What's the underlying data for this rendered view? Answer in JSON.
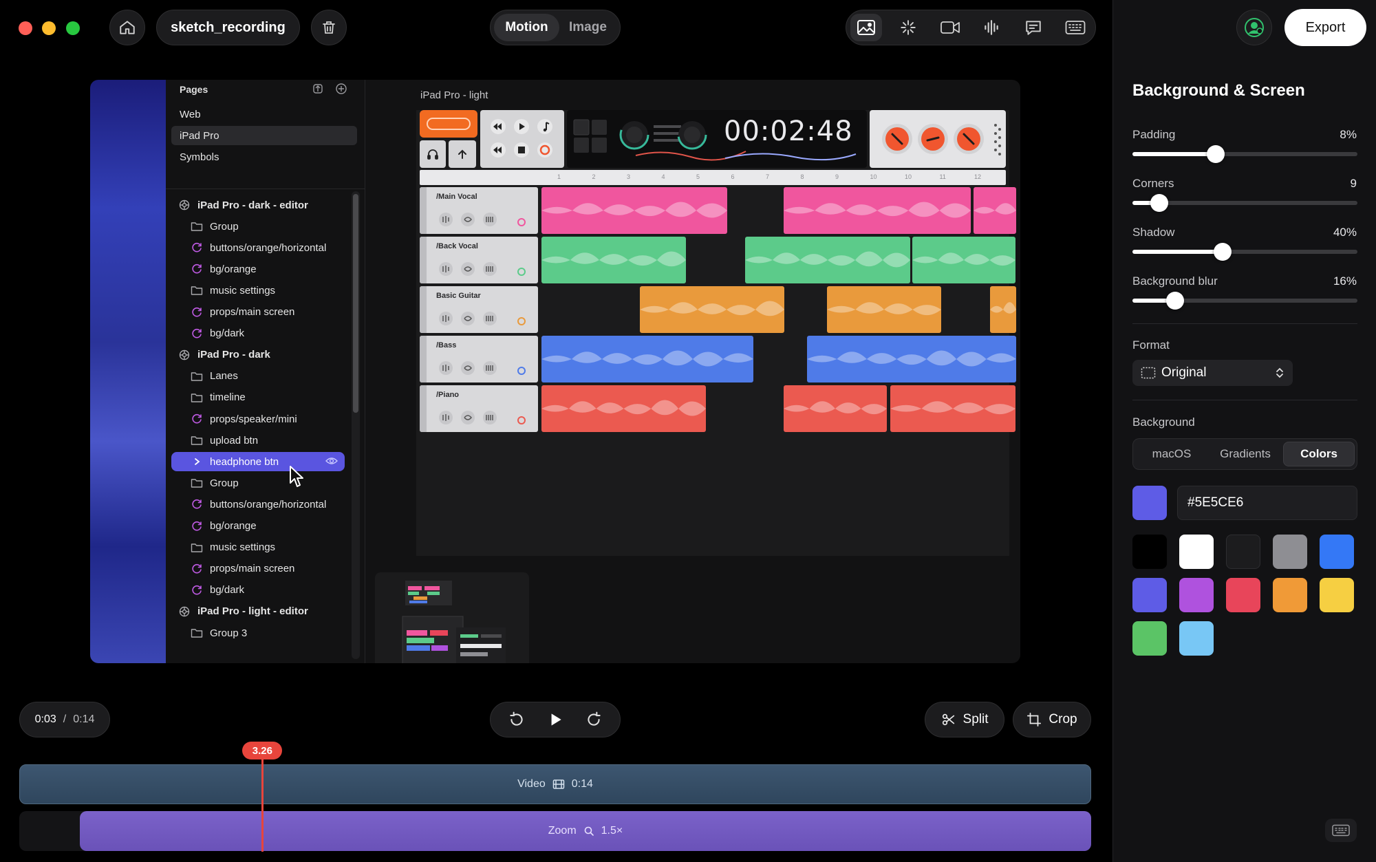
{
  "window": {
    "traffic_lights": [
      "#ff5f57",
      "#febc2e",
      "#28c840"
    ],
    "project_name": "sketch_recording"
  },
  "mode_toggle": {
    "options": [
      "Motion",
      "Image"
    ],
    "selected": "Motion"
  },
  "toolbar_icons": [
    "image-icon",
    "sparkle-icon",
    "camera-icon",
    "waveform-icon",
    "chat-bubble-icon",
    "keyboard-icon"
  ],
  "export_label": "Export",
  "layers_panel": {
    "pages_label": "Pages",
    "pages": [
      "Web",
      "iPad Pro",
      "Symbols"
    ],
    "selected_page": "iPad Pro",
    "layers": [
      {
        "type": "component",
        "label": "iPad Pro - dark - editor",
        "level": 0
      },
      {
        "type": "folder",
        "label": "Group",
        "level": 1
      },
      {
        "type": "symbol",
        "label": "buttons/orange/horizontal",
        "level": 1
      },
      {
        "type": "symbol",
        "label": "bg/orange",
        "level": 1
      },
      {
        "type": "folder",
        "label": "music settings",
        "level": 1
      },
      {
        "type": "symbol",
        "label": "props/main screen",
        "level": 1
      },
      {
        "type": "symbol",
        "label": "bg/dark",
        "level": 1
      },
      {
        "type": "component",
        "label": "iPad Pro - dark",
        "level": 0
      },
      {
        "type": "folder",
        "label": "Lanes",
        "level": 1
      },
      {
        "type": "folder",
        "label": "timeline",
        "level": 1
      },
      {
        "type": "symbol",
        "label": "props/speaker/mini",
        "level": 1
      },
      {
        "type": "folder",
        "label": "upload btn",
        "level": 1
      },
      {
        "type": "selected",
        "label": "headphone btn",
        "level": 1
      },
      {
        "type": "folder",
        "label": "Group",
        "level": 1
      },
      {
        "type": "symbol",
        "label": "buttons/orange/horizontal",
        "level": 1
      },
      {
        "type": "symbol",
        "label": "bg/orange",
        "level": 1
      },
      {
        "type": "folder",
        "label": "music settings",
        "level": 1
      },
      {
        "type": "symbol",
        "label": "props/main screen",
        "level": 1
      },
      {
        "type": "symbol",
        "label": "bg/dark",
        "level": 1
      },
      {
        "type": "component",
        "label": "iPad Pro - light - editor",
        "level": 0
      },
      {
        "type": "folder",
        "label": "Group 3",
        "level": 1
      }
    ]
  },
  "artboard": {
    "title": "iPad Pro - light",
    "time_display": "00:02:48",
    "ruler_numbers": [
      "1",
      "2",
      "3",
      "4",
      "5",
      "6",
      "7",
      "8",
      "9",
      "10",
      "10",
      "11",
      "12"
    ],
    "tracks": [
      {
        "name": "/Main Vocal",
        "color": "#f0569e"
      },
      {
        "name": "/Back Vocal",
        "color": "#5ccb8a"
      },
      {
        "name": "Basic Guitar",
        "color": "#e99a3c"
      },
      {
        "name": "/Bass",
        "color": "#4f7be8"
      },
      {
        "name": "/Piano",
        "color": "#eb5a50"
      }
    ]
  },
  "playback": {
    "current_time": "0:03",
    "separator": "/",
    "total_time": "0:14",
    "split_label": "Split",
    "crop_label": "Crop"
  },
  "timeline": {
    "playhead_label": "3.26",
    "playhead_fraction": 0.2268,
    "video_track": {
      "label": "Video",
      "duration": "0:14"
    },
    "zoom_track": {
      "label": "Zoom",
      "value": "1.5×"
    }
  },
  "settings_panel": {
    "title": "Background & Screen",
    "sliders": [
      {
        "label": "Padding",
        "value": "8%",
        "fraction": 0.37
      },
      {
        "label": "Corners",
        "value": "9",
        "fraction": 0.12
      },
      {
        "label": "Shadow",
        "value": "40%",
        "fraction": 0.4
      },
      {
        "label": "Background blur",
        "value": "16%",
        "fraction": 0.19
      }
    ],
    "format_label": "Format",
    "format_value": "Original",
    "background_label": "Background",
    "background_tabs": [
      "macOS",
      "Gradients",
      "Colors"
    ],
    "selected_background_tab": "Colors",
    "hex_value": "#5E5CE6",
    "swatches": [
      "#000000",
      "#ffffff",
      "#1c1c1e",
      "#8e8e93",
      "#3478f6",
      "#5e5ce6",
      "#af52de",
      "#e8455a",
      "#f09a37",
      "#f6cf42",
      "#5bc466",
      "#78c7f5"
    ]
  }
}
